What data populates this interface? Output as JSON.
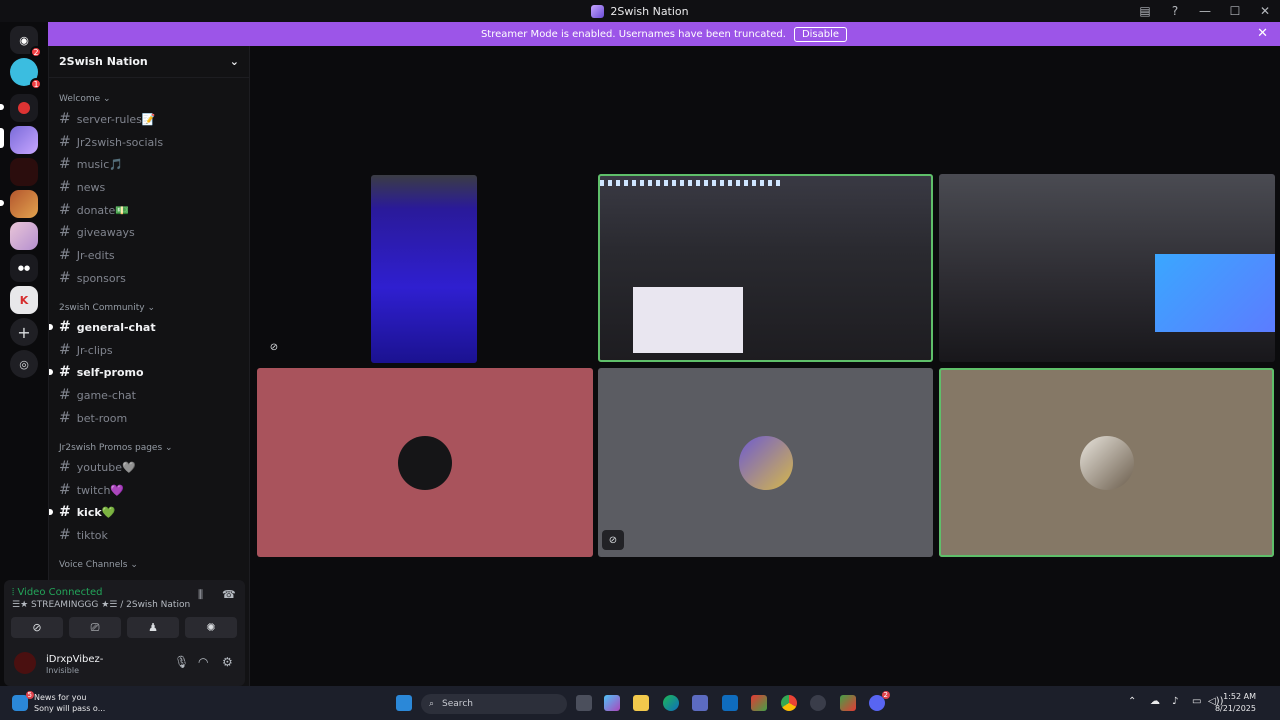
{
  "window": {
    "title": "2Swish Nation",
    "controls": [
      "minimize",
      "maximize",
      "close"
    ]
  },
  "banner": {
    "text": "Streamer Mode is enabled. Usernames have been truncated.",
    "disable_label": "Disable"
  },
  "servers": {
    "dm_badge": "2",
    "second_badge": "1"
  },
  "sidebar": {
    "server_name": "2Swish Nation",
    "categories": [
      {
        "name": "Welcome"
      },
      {
        "name": "2swish Community"
      },
      {
        "name": "Jr2swish Promos pages"
      },
      {
        "name": "Voice Channels"
      }
    ],
    "channels": [
      {
        "name": "server-rules📝"
      },
      {
        "name": "Jr2swish-socials"
      },
      {
        "name": "music🎵"
      },
      {
        "name": "news"
      },
      {
        "name": "donate💵"
      },
      {
        "name": "giveaways"
      },
      {
        "name": "Jr-edits"
      },
      {
        "name": "sponsors"
      },
      {
        "name": "general-chat"
      },
      {
        "name": "Jr-clips"
      },
      {
        "name": "self-promo"
      },
      {
        "name": "game-chat"
      },
      {
        "name": "bet-room"
      },
      {
        "name": "youtube🩶"
      },
      {
        "name": "twitch💜"
      },
      {
        "name": "kick💚"
      },
      {
        "name": "tiktok"
      }
    ]
  },
  "voice": {
    "status": "Video Connected",
    "channel": "☰★ STREAMINGGG ★☰ / 2Swish Nation"
  },
  "user": {
    "name": "iDrxpVibez-",
    "status": "Invisible"
  },
  "taskbar": {
    "news_title": "News for you",
    "news_sub": "Sony will pass o...",
    "news_badge": "5",
    "search_placeholder": "Search",
    "time": "1:52 AM",
    "date": "8/21/2025",
    "discord_badge": "2"
  },
  "colors": {
    "banner": "#9c55e8",
    "tile_red": "#a9535c",
    "tile_grey": "#5b5c62",
    "tile_tan": "#857866",
    "speaking": "#5fbf6a"
  }
}
